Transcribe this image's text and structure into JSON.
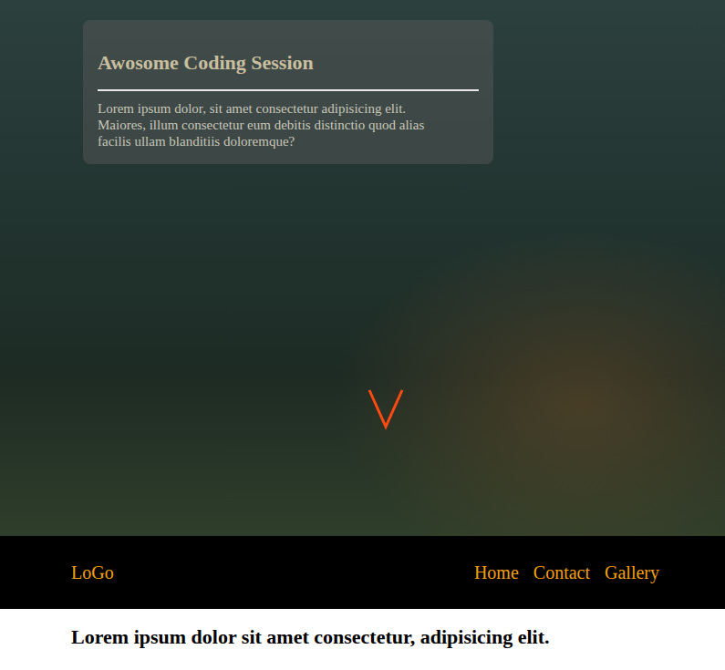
{
  "hero": {
    "card": {
      "title": "Awosome Coding Session",
      "text": "Lorem ipsum dolor, sit amet consectetur adipisicing elit. Maiores, illum consectetur eum debitis distinctio quod alias facilis ullam blanditiis doloremque?"
    }
  },
  "navbar": {
    "logo": "LoGo",
    "links": [
      {
        "label": "Home"
      },
      {
        "label": "Contact"
      },
      {
        "label": "Gallery"
      }
    ]
  },
  "content": {
    "heading": "Lorem ipsum dolor sit amet consectetur, adipisicing elit."
  }
}
